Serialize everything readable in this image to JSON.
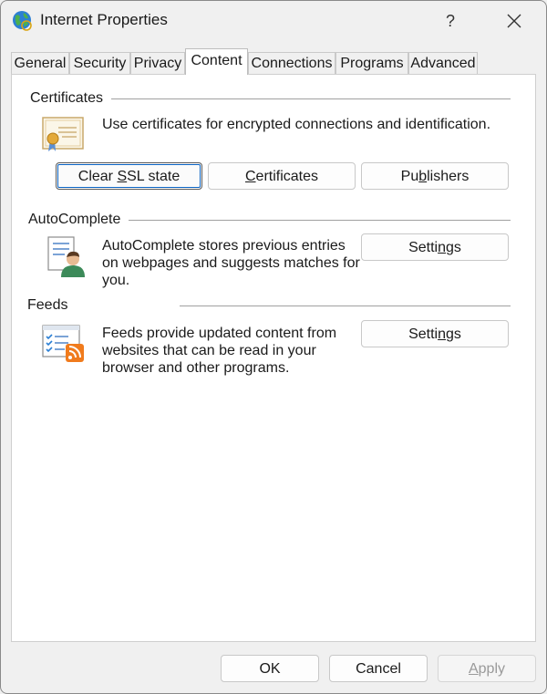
{
  "window": {
    "title": "Internet Properties",
    "help_label": "?"
  },
  "tabs": [
    {
      "label": "General"
    },
    {
      "label": "Security"
    },
    {
      "label": "Privacy"
    },
    {
      "label": "Content",
      "active": true
    },
    {
      "label": "Connections"
    },
    {
      "label": "Programs"
    },
    {
      "label": "Advanced"
    }
  ],
  "certificates": {
    "heading": "Certificates",
    "description": "Use certificates for encrypted connections and identification.",
    "clear_ssl": {
      "pre": "Clear ",
      "ul": "S",
      "post": "SL state"
    },
    "certificates_btn": {
      "pre": "",
      "ul": "C",
      "post": "ertificates"
    },
    "publishers_btn": {
      "pre": "Pu",
      "ul": "b",
      "post": "lishers"
    }
  },
  "autocomplete": {
    "heading": "AutoComplete",
    "description_lines": [
      "AutoComplete stores previous entries",
      "on webpages and suggests matches for",
      "you."
    ],
    "settings_btn": {
      "pre": "Setti",
      "ul": "n",
      "post": "gs"
    }
  },
  "feeds": {
    "heading": "Feeds",
    "description_lines": [
      "Feeds provide updated content from",
      "websites that can be read in your",
      "browser and other programs."
    ],
    "settings_btn": {
      "pre": "Setti",
      "ul": "n",
      "post": "gs"
    }
  },
  "footer": {
    "ok": "OK",
    "cancel": "Cancel",
    "apply": {
      "pre": "",
      "ul": "A",
      "post": "pply"
    }
  },
  "colors": {
    "panel": "#ffffff",
    "dialog": "#f0f0f0",
    "focus": "#0a63c2",
    "rss": "#f07b1d"
  }
}
